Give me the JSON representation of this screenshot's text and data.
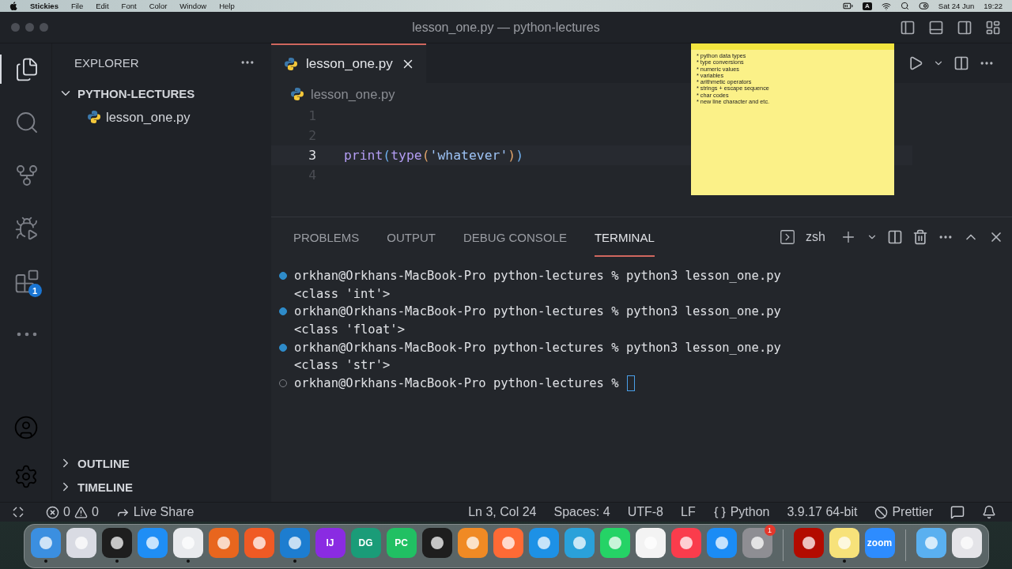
{
  "menubar": {
    "app": "Stickies",
    "menus": [
      "File",
      "Edit",
      "Font",
      "Color",
      "Window",
      "Help"
    ],
    "input_source": "A",
    "date": "Sat 24 Jun",
    "time": "19:22"
  },
  "window": {
    "title": "lesson_one.py — python-lectures"
  },
  "activity_bar": {
    "items": [
      {
        "kind": "files",
        "selected": true
      },
      {
        "kind": "search",
        "selected": false
      },
      {
        "kind": "source_control",
        "selected": false
      },
      {
        "kind": "run",
        "selected": false
      },
      {
        "kind": "extensions",
        "selected": false,
        "badge": "1"
      },
      {
        "kind": "more",
        "selected": false
      }
    ],
    "bottom": [
      {
        "kind": "account"
      },
      {
        "kind": "settings"
      }
    ]
  },
  "sidebar": {
    "title": "EXPLORER",
    "tree": [
      {
        "label": "PYTHON-LECTURES",
        "kind": "folder",
        "expanded": true,
        "children": [
          {
            "label": "lesson_one.py",
            "kind": "python"
          }
        ]
      }
    ],
    "sections": [
      {
        "label": "OUTLINE",
        "expanded": false
      },
      {
        "label": "TIMELINE",
        "expanded": false
      }
    ]
  },
  "editor": {
    "tabs": [
      {
        "label": "lesson_one.py",
        "selected": true
      }
    ],
    "breadcrumb": "lesson_one.py",
    "lines": [
      {
        "number": "1",
        "current": false
      },
      {
        "number": "2",
        "current": false
      },
      {
        "number": "3",
        "current": true,
        "tokens": [
          {
            "kind": "function",
            "text": "print"
          },
          {
            "kind": "bracket1",
            "text": "("
          },
          {
            "kind": "function",
            "text": "type"
          },
          {
            "kind": "bracket2",
            "text": "("
          },
          {
            "kind": "string",
            "text": "'whatever'"
          },
          {
            "kind": "bracket2",
            "text": ")"
          },
          {
            "kind": "bracket1",
            "text": ")"
          }
        ]
      },
      {
        "number": "4",
        "current": false
      }
    ]
  },
  "sticky_note": {
    "lines": [
      "* python data types",
      "* type conversions",
      "* numeric values",
      "* variables",
      "* arithmetic operators",
      "* strings + escape sequence",
      "* char codes",
      "* new line character and etc."
    ]
  },
  "panel": {
    "tabs": [
      {
        "label": "PROBLEMS",
        "selected": false
      },
      {
        "label": "OUTPUT",
        "selected": false
      },
      {
        "label": "DEBUG CONSOLE",
        "selected": false
      },
      {
        "label": "TERMINAL",
        "selected": true
      }
    ],
    "shell": "zsh",
    "terminal": [
      {
        "kind": "command",
        "done": true,
        "text": "orkhan@Orkhans-MacBook-Pro python-lectures % python3 lesson_one.py"
      },
      {
        "kind": "output",
        "text": "<class 'int'>"
      },
      {
        "kind": "command",
        "done": true,
        "text": "orkhan@Orkhans-MacBook-Pro python-lectures % python3 lesson_one.py"
      },
      {
        "kind": "output",
        "text": "<class 'float'>"
      },
      {
        "kind": "command",
        "done": true,
        "text": "orkhan@Orkhans-MacBook-Pro python-lectures % python3 lesson_one.py"
      },
      {
        "kind": "output",
        "text": "<class 'str'>"
      },
      {
        "kind": "command",
        "done": false,
        "cursor": true,
        "text": "orkhan@Orkhans-MacBook-Pro python-lectures %"
      }
    ]
  },
  "status_bar": {
    "errors": "0",
    "warnings": "0",
    "live_share": "Live Share",
    "items": [
      "Ln 3, Col 24",
      "Spaces: 4",
      "UTF-8",
      "LF"
    ],
    "language": "Python",
    "interpreter": "3.9.17 64-bit",
    "formatter": "Prettier"
  },
  "dock": {
    "groups": [
      [
        {
          "color": "#3b8fe0",
          "running": true
        },
        {
          "color": "#d9dbe3",
          "running": false
        },
        {
          "color": "#1e1e1e",
          "running": true
        },
        {
          "color": "#1f8ef5",
          "running": false
        },
        {
          "color": "#e8eaed",
          "running": true
        },
        {
          "color": "#e8661e",
          "running": false
        },
        {
          "color": "#f05a24",
          "running": false
        },
        {
          "color": "#1d7dd0",
          "running": true
        },
        {
          "color": "#8a2be2",
          "label": "IJ",
          "running": false
        },
        {
          "color": "#1a9c78",
          "label": "DG",
          "running": false
        },
        {
          "color": "#21c063",
          "label": "PC",
          "running": false
        },
        {
          "color": "#1e1e1e",
          "running": false
        },
        {
          "color": "#f08a24",
          "running": false
        },
        {
          "color": "#ff6a35",
          "running": false
        },
        {
          "color": "#1d91e6",
          "running": false
        },
        {
          "color": "#2aa1da",
          "running": false
        },
        {
          "color": "#25d366",
          "running": false
        },
        {
          "color": "#f3f3f3",
          "running": false
        },
        {
          "color": "#fa3c4c",
          "running": false
        },
        {
          "color": "#1b8cf5",
          "running": false
        },
        {
          "color": "#8e8e93",
          "badge": "1",
          "running": false
        }
      ],
      [
        {
          "color": "#b30b00",
          "running": false
        },
        {
          "color": "#f7e27a",
          "running": true
        },
        {
          "color": "#2d8cff",
          "label": "zoom",
          "running": false
        }
      ],
      [
        {
          "color": "#5ab0f0",
          "running": false
        },
        {
          "color": "#e4e4e8",
          "running": false
        }
      ]
    ]
  }
}
